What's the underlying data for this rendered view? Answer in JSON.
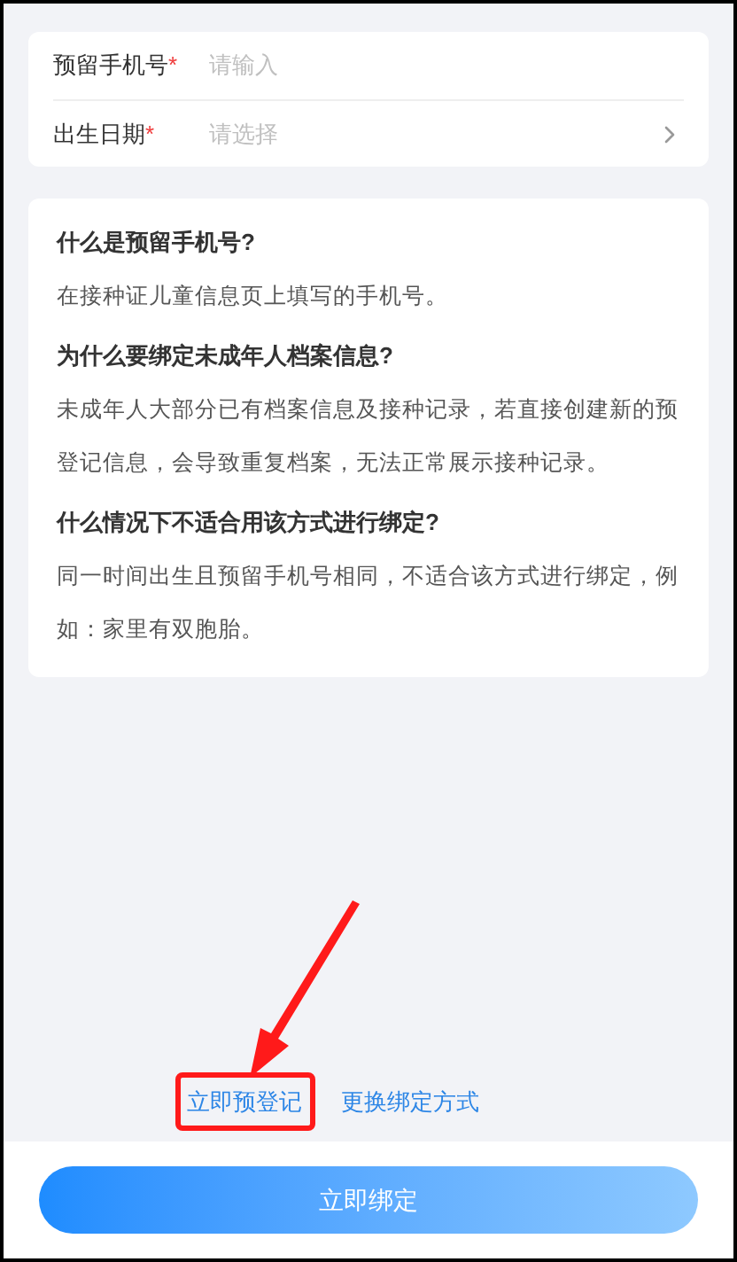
{
  "form": {
    "fields": [
      {
        "label": "预留手机号",
        "required_mark": "*",
        "placeholder": "请输入",
        "kind": "input"
      },
      {
        "label": "出生日期",
        "required_mark": "*",
        "placeholder": "请选择",
        "kind": "select"
      }
    ]
  },
  "faq": [
    {
      "question": "什么是预留手机号?",
      "answer": "在接种证儿童信息页上填写的手机号。"
    },
    {
      "question": "为什么要绑定未成年人档案信息?",
      "answer": "未成年人大部分已有档案信息及接种记录，若直接创建新的预登记信息，会导致重复档案，无法正常展示接种记录。"
    },
    {
      "question": "什么情况下不适合用该方式进行绑定?",
      "answer": "同一时间出生且预留手机号相同，不适合该方式进行绑定，例如：家里有双胞胎。"
    }
  ],
  "links": [
    {
      "label": "立即预登记",
      "highlighted": true
    },
    {
      "label": "更换绑定方式",
      "highlighted": false
    }
  ],
  "primary_button": "立即绑定"
}
